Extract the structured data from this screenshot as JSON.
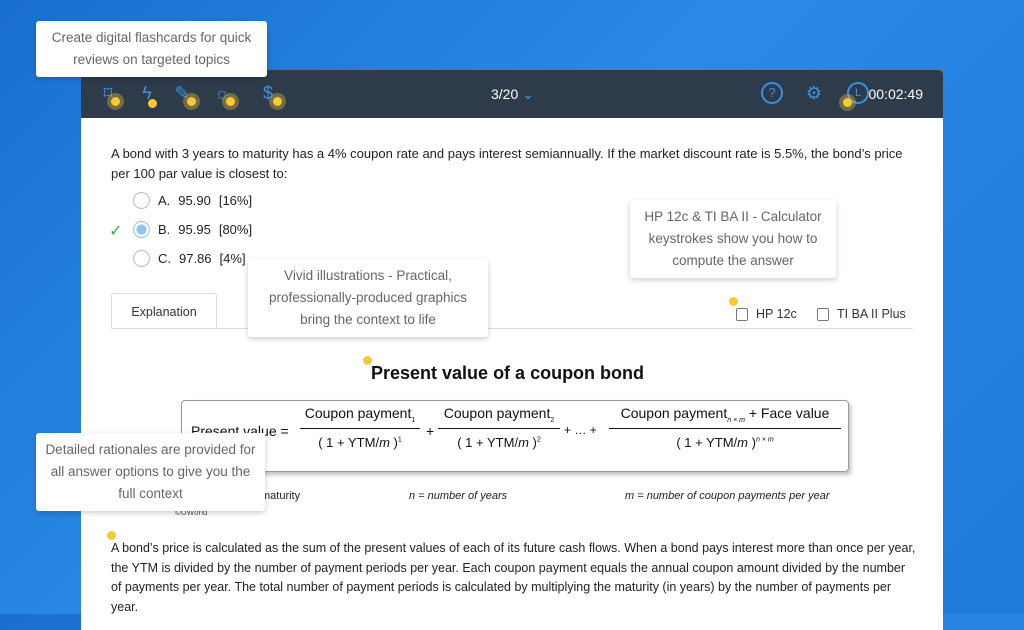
{
  "header": {
    "counter": "3/20",
    "timer": "00:02:49",
    "icons": [
      "bookmark-icon",
      "flashcard-bolt-icon",
      "notes-icon",
      "lightbulb-icon",
      "dollar-icon"
    ],
    "right_icons": [
      "help-icon",
      "settings-icon",
      "clock-icon"
    ]
  },
  "question": {
    "text": "A bond with 3 years to maturity has a 4% coupon rate and pays interest semiannually.  If the market discount rate is 5.5%, the bond’s price per 100 par value is closest to:",
    "options": [
      {
        "letter": "A.",
        "value": "95.90",
        "pct": "[16%]"
      },
      {
        "letter": "B.",
        "value": "95.95",
        "pct": "[80%]",
        "selected": true,
        "correct": true
      },
      {
        "letter": "C.",
        "value": "97.86",
        "pct": "[4%]"
      }
    ]
  },
  "explanation": {
    "tab": "Explanation",
    "calculators": [
      "HP 12c",
      "TI BA II Plus"
    ],
    "figure": {
      "title": "Present value of a coupon bond",
      "lhs": "Present value =",
      "num1": "Coupon payment",
      "sub1": "1",
      "num2": "Coupon payment",
      "sub2": "2",
      "num3": "Coupon payment",
      "sub3": "n × m",
      "num3b": "+ Face value",
      "den": "1 +",
      "ytm": "YTM",
      "m": "m",
      "exp1": "1",
      "exp2": "2",
      "exp3": "n × m",
      "plus": "+",
      "ellipsis": "+ … +",
      "legend": [
        "maturity",
        "n = number of years",
        "m = number of coupon payments per year"
      ],
      "copyright": "©UWorld"
    },
    "paragraph": "A bond’s price is calculated as the sum of the present values of each of its future cash flows.  When a bond pays interest more than once per year, the YTM is divided by the number of payment periods per year.  Each coupon payment equals the annual coupon amount divided by the number of payments per year.  The total number of payment periods is calculated by multiplying the maturity (in years) by the number of payments per year."
  },
  "tooltips": {
    "flashcards": "Create digital flashcards for quick reviews on targeted topics",
    "calculator": "HP 12c & TI BA II - Calculator keystrokes show you how to compute the answer",
    "illustrations": "Vivid illustrations - Practical, professionally-produced graphics bring the context to life",
    "rationales": "Detailed rationales are provided for all answer options to give you the full context"
  },
  "colors": {
    "header": "#2e3b4b",
    "accent": "#3d8fe0",
    "highlight": "#f7c935",
    "correct": "#3aa84a"
  }
}
